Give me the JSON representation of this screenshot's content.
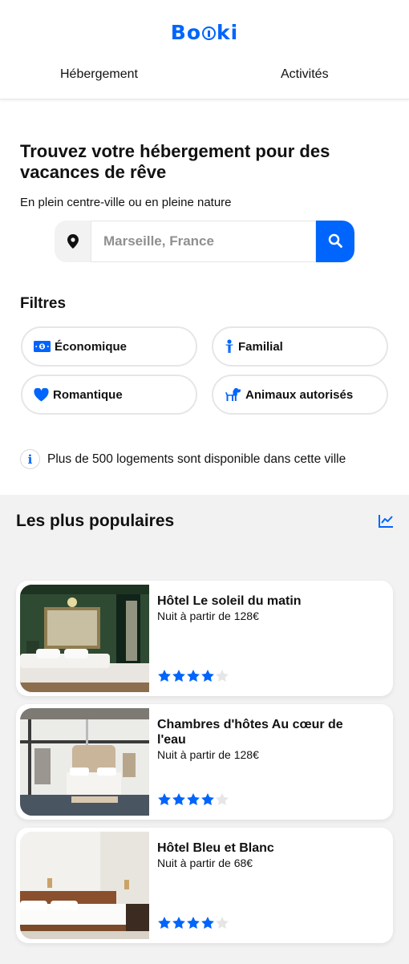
{
  "brand": {
    "logo_text": "Booki",
    "accent_color": "#0065fc"
  },
  "nav": {
    "tabs": [
      {
        "label": "Hébergement"
      },
      {
        "label": "Activités"
      }
    ]
  },
  "search": {
    "title": "Trouvez votre hébergement pour des vacances de rêve",
    "subtitle": "En plein centre-ville ou en pleine nature",
    "placeholder": "Marseille, France",
    "location_icon": "location-pin-icon",
    "button_icon": "search-icon"
  },
  "filters": {
    "title": "Filtres",
    "items": [
      {
        "label": "Économique",
        "icon": "money-icon"
      },
      {
        "label": "Familial",
        "icon": "child-icon"
      },
      {
        "label": "Romantique",
        "icon": "heart-icon"
      },
      {
        "label": "Animaux autorisés",
        "icon": "dog-icon"
      }
    ]
  },
  "info": {
    "icon": "info-icon",
    "text": "Plus de 500 logements sont disponible dans cette ville"
  },
  "popular": {
    "title": "Les plus populaires",
    "icon": "trend-chart-icon",
    "cards": [
      {
        "name": "Hôtel Le soleil du matin",
        "price": "Nuit à partir de 128€",
        "rating": 4,
        "max_rating": 5
      },
      {
        "name": "Chambres d'hôtes Au cœur de l'eau",
        "price": "Nuit à partir de 128€",
        "rating": 4,
        "max_rating": 5
      },
      {
        "name": "Hôtel Bleu et Blanc",
        "price": "Nuit à partir de 68€",
        "rating": 4,
        "max_rating": 5
      }
    ]
  }
}
